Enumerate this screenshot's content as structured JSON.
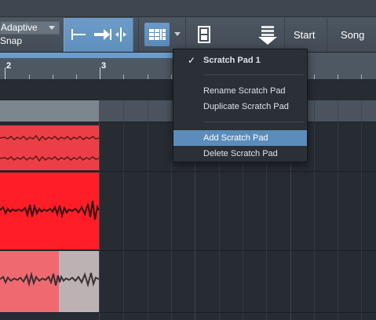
{
  "toolbar": {
    "quantize_value": "Adaptive",
    "snap_label": "Snap",
    "start_label": "Start",
    "song_label": "Song"
  },
  "ruler": {
    "bars": [
      "2",
      "3"
    ]
  },
  "scratch_pad_menu": {
    "items": [
      {
        "label": "Scratch Pad 1",
        "checked": true
      },
      {
        "label": "Rename Scratch Pad"
      },
      {
        "label": "Duplicate Scratch Pad"
      },
      {
        "label": "Add Scratch Pad",
        "highlighted": true
      },
      {
        "label": "Delete Scratch Pad"
      }
    ]
  },
  "colors": {
    "accent_blue": "#6c9cc9",
    "menu_highlight": "#5b8cbb",
    "clip_red": "#ff1e28",
    "clip_pink": "#ec3e46"
  }
}
